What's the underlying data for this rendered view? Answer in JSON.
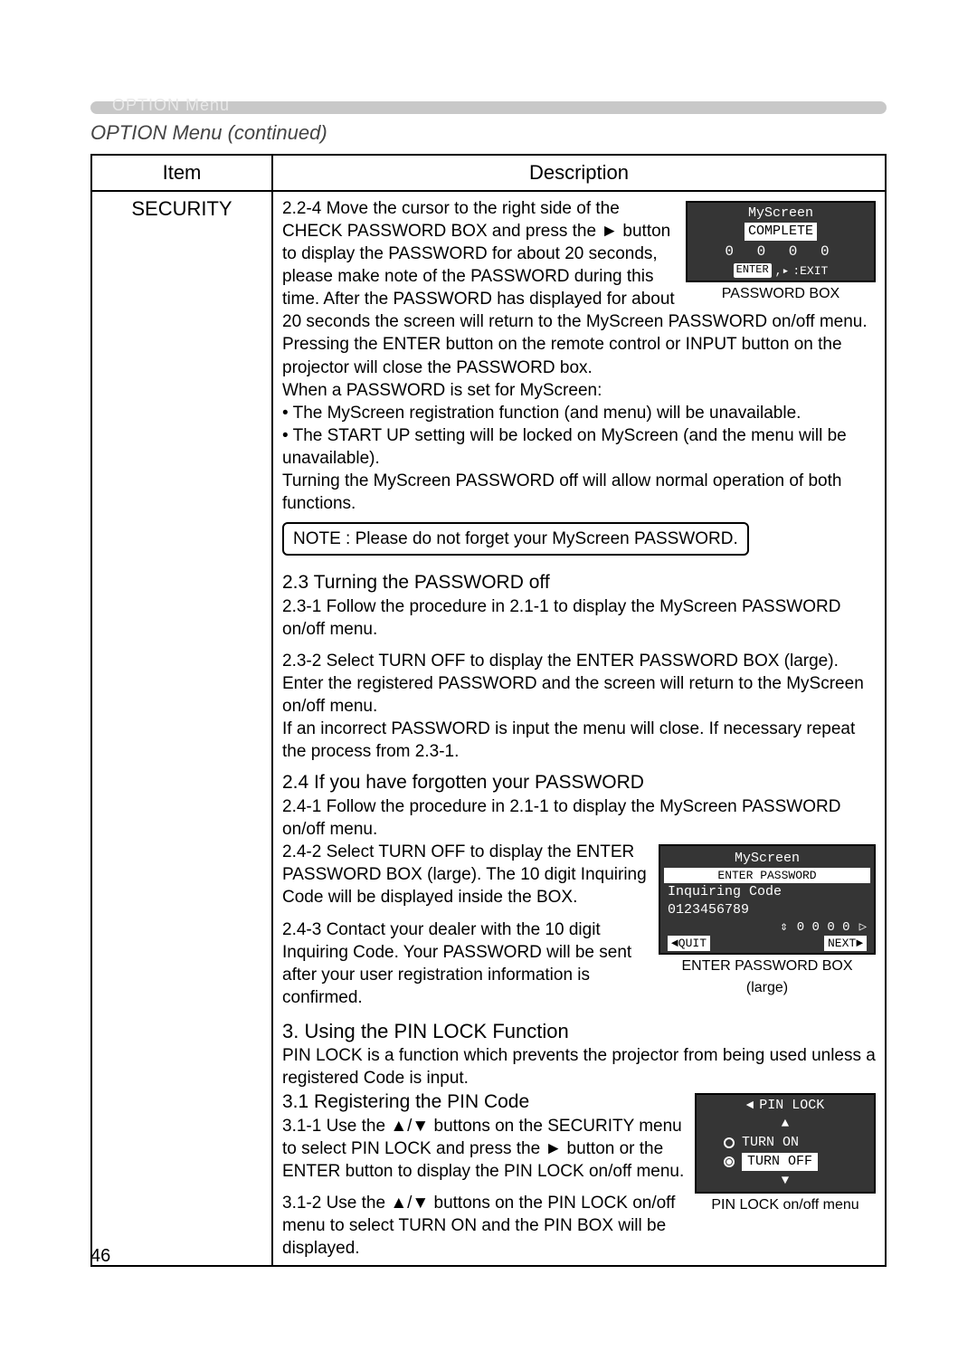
{
  "tab": {
    "label": "OPTION Menu"
  },
  "section_title": "OPTION Menu (continued)",
  "table": {
    "head_item": "Item",
    "head_desc": "Description",
    "item": "SECURITY"
  },
  "s224": {
    "lead": "2.2-4",
    "body1": "Move the cursor to the right side of the CHECK PASSWORD BOX and press the ► button to display the PASSWORD for about 20 seconds, please make note of the PASSWORD during this time. After the PASSWORD has displayed for about 20 seconds the screen will return to the MyScreen PASSWORD on/off menu.",
    "body2": "Pressing the ENTER button on the remote control or INPUT button on the projector will close the PASSWORD box.",
    "body3": "When a PASSWORD is set for MyScreen:",
    "bul1": "• The MyScreen registration function (and menu) will be unavailable.",
    "bul2": "• The START UP setting will be locked on MyScreen (and the menu will be unavailable).",
    "body4": "Turning the MyScreen PASSWORD off will allow normal operation of both functions."
  },
  "note": "NOTE : Please do not forget your MyScreen PASSWORD.",
  "s23": {
    "title": "2.3 Turning the PASSWORD off",
    "p1": "2.3-1 Follow the procedure in 2.1-1 to display the MyScreen PASSWORD on/off menu.",
    "p2a": "2.3-2 Select TURN OFF to display the ENTER PASSWORD BOX (large). Enter the registered PASSWORD and the screen will return to the MyScreen on/off menu.",
    "p2b": "If an incorrect PASSWORD is input the menu will close. If necessary repeat the process from 2.3-1."
  },
  "s24": {
    "title": "2.4 If you have forgotten your PASSWORD",
    "p1": "2.4-1 Follow the procedure in 2.1-1 to display the MyScreen PASSWORD on/off menu.",
    "p2": "2.4-2 Select TURN OFF to display the ENTER PASSWORD BOX (large). The 10 digit Inquiring Code will be displayed inside the BOX.",
    "p3": "2.4-3 Contact your dealer with the 10 digit Inquiring Code. Your PASSWORD will be sent after your user registration information is confirmed."
  },
  "s3": {
    "title": "3. Using the PIN LOCK Function",
    "intro": "PIN LOCK is a function which prevents the projector from being used unless a registered Code is input.",
    "s31": "3.1 Registering the PIN Code",
    "p1": "3.1-1 Use the ▲/▼ buttons on the SECURITY menu to select PIN LOCK and press the ► button or the ENTER button to display the PIN LOCK on/off menu.",
    "p2": "3.1-2 Use the ▲/▼ buttons on the PIN LOCK on/off menu to select TURN ON and the PIN BOX will be displayed."
  },
  "box_pw": {
    "title": "MyScreen",
    "complete": "COMPLETE",
    "digits": "0 0 0 0",
    "enter": "ENTER",
    "exit": ":EXIT",
    "caption": "PASSWORD BOX"
  },
  "box_enter": {
    "title": "MyScreen",
    "sub": "ENTER PASSWORD",
    "inq": "Inquiring Code",
    "code": "0123456789",
    "cur": "0  0  0  0",
    "quit": "◄QUIT",
    "next": "NEXT►",
    "caption1": "ENTER PASSWORD BOX",
    "caption2": "(large)"
  },
  "box_pin": {
    "title": "PIN LOCK",
    "on": "TURN ON",
    "off": "TURN OFF",
    "caption": "PIN LOCK on/off menu"
  },
  "page_number": "46"
}
